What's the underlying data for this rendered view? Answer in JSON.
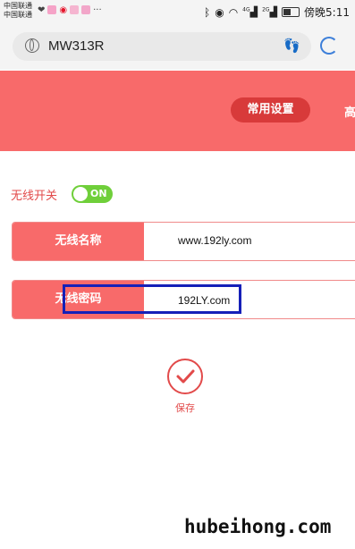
{
  "status_bar": {
    "carrier_1": "中国联通",
    "carrier_2": "中国联通",
    "signal_1": "4G",
    "signal_2": "2G",
    "time": "傍晚5:11"
  },
  "browser": {
    "url": "MW313R"
  },
  "header": {
    "tab_common": "常用设置",
    "tab_advanced": "高"
  },
  "wireless": {
    "switch_label": "无线开关",
    "switch_state": "ON",
    "name_label": "无线名称",
    "name_value": "www.192ly.com",
    "password_label": "无线密码",
    "password_value": "192LY.com"
  },
  "actions": {
    "save_label": "保存"
  },
  "watermark": "hubeihong.com",
  "colors": {
    "accent": "#f86a6a",
    "accent_dark": "#d83a3a",
    "toggle_on": "#6fcf3a",
    "highlight_box": "#1520b8",
    "reload_blue": "#3d7fd9"
  }
}
